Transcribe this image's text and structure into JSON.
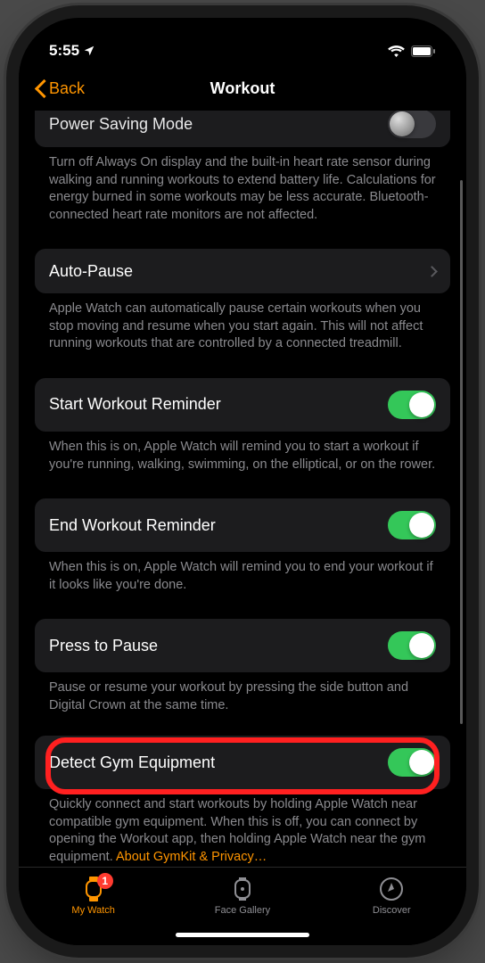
{
  "status": {
    "time": "5:55",
    "location_active": true
  },
  "nav": {
    "back_label": "Back",
    "title": "Workout"
  },
  "sections": {
    "power_saving": {
      "label": "Power Saving Mode",
      "on": false,
      "footer": "Turn off Always On display and the built-in heart rate sensor during walking and running workouts to extend battery life. Calculations for energy burned in some workouts may be less accurate. Bluetooth-connected heart rate monitors are not affected."
    },
    "auto_pause": {
      "label": "Auto-Pause",
      "footer": "Apple Watch can automatically pause certain workouts when you stop moving and resume when you start again. This will not affect running workouts that are controlled by a connected treadmill."
    },
    "start_reminder": {
      "label": "Start Workout Reminder",
      "on": true,
      "footer": "When this is on, Apple Watch will remind you to start a workout if you're running, walking, swimming, on the elliptical, or on the rower."
    },
    "end_reminder": {
      "label": "End Workout Reminder",
      "on": true,
      "footer": "When this is on, Apple Watch will remind you to end your workout if it looks like you're done."
    },
    "press_pause": {
      "label": "Press to Pause",
      "on": true,
      "footer": "Pause or resume your workout by pressing the side button and Digital Crown at the same time."
    },
    "detect_gym": {
      "label": "Detect Gym Equipment",
      "on": true,
      "footer": "Quickly connect and start workouts by holding Apple Watch near compatible gym equipment. When this is off, you can connect by opening the Workout app, then holding Apple Watch near the gym equipment. ",
      "link": "About GymKit & Privacy…"
    }
  },
  "tabs": {
    "my_watch": {
      "label": "My Watch",
      "badge": "1"
    },
    "face_gallery": {
      "label": "Face Gallery"
    },
    "discover": {
      "label": "Discover"
    }
  }
}
